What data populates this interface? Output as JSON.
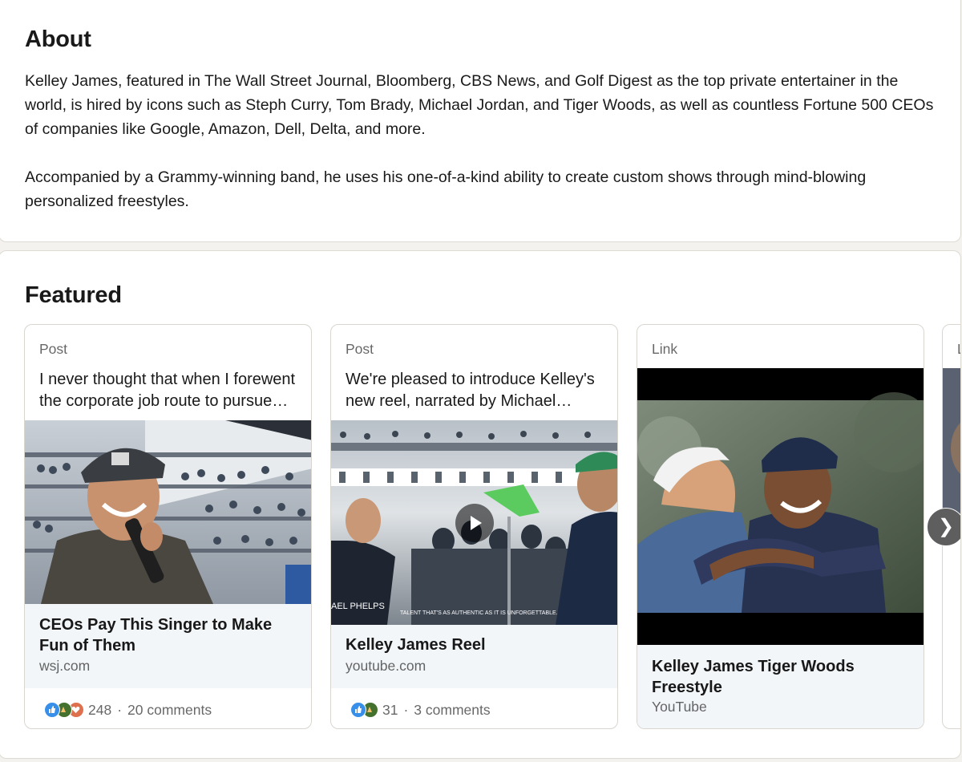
{
  "about": {
    "title": "About",
    "paragraph1": "Kelley James, featured in The Wall Street Journal, Bloomberg, CBS News, and Golf Digest as the top private entertainer in the world, is hired by icons such as Steph Curry, Tom Brady, Michael Jordan, and Tiger Woods, as well as countless Fortune 500 CEOs of companies like Google, Amazon, Dell, Delta, and more.",
    "paragraph2": "Accompanied by a Grammy-winning band, he uses his one-of-a-kind ability to create custom shows through mind-blowing personalized freestyles."
  },
  "featured": {
    "title": "Featured",
    "items": [
      {
        "type": "Post",
        "description": "I never thought that when I forewent the corporate job route to pursue music full-time",
        "link_title": "CEOs Pay This Singer to Make Fun of Them",
        "source": "wsj.com",
        "reaction_count": "248",
        "comments": "20 comments"
      },
      {
        "type": "Post",
        "description": "We're pleased to introduce Kelley's new reel, narrated by Michael Phelps",
        "link_title": "Kelley James Reel",
        "source": "youtube.com",
        "reaction_count": "31",
        "comments": "3 comments",
        "video_caption_left": "AEL PHELPS",
        "video_caption_right": "TALENT THAT'S AS AUTHENTIC AS IT IS UNFORGETTABLE."
      },
      {
        "type": "Link",
        "link_title": "Kelley James Tiger Woods Freestyle",
        "source": "YouTube"
      },
      {
        "type": "L"
      }
    ],
    "separator": "·"
  },
  "colors": {
    "like": "#378fe9",
    "celebrate": "#44712e",
    "love": "#df704d",
    "meta_bg": "#f3f6f8"
  },
  "icons": {
    "play": "play-icon",
    "next": "chevron-right-icon"
  }
}
